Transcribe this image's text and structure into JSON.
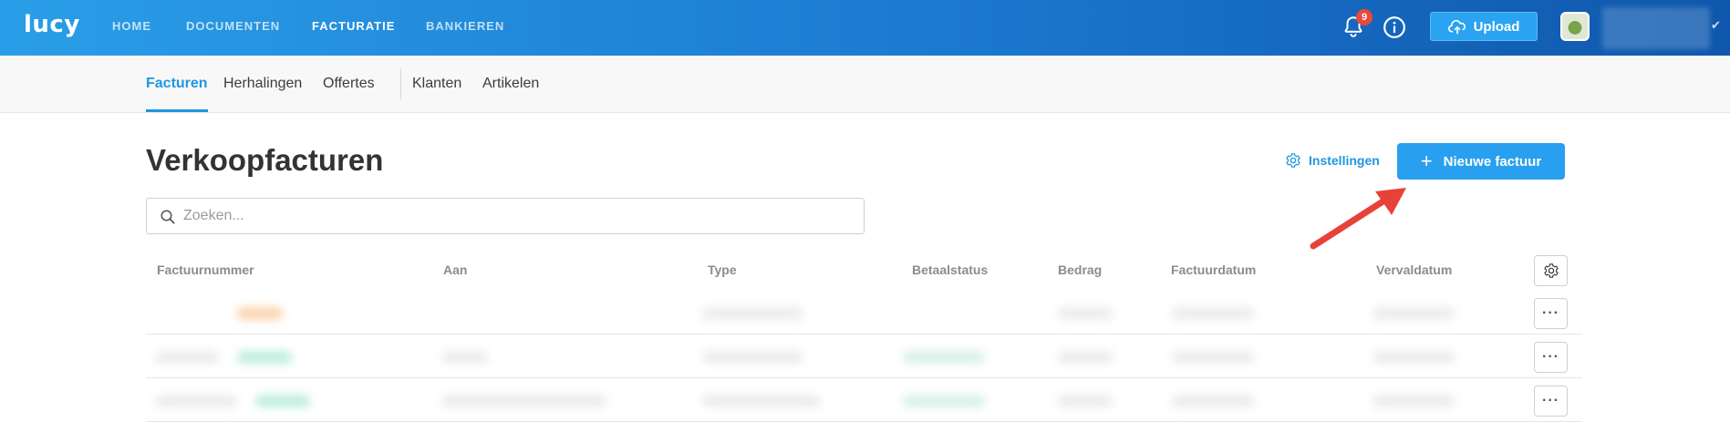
{
  "app": {
    "logo": "lucy"
  },
  "topnav": {
    "items": [
      {
        "label": "HOME",
        "active": false
      },
      {
        "label": "DOCUMENTEN",
        "active": false
      },
      {
        "label": "FACTURATIE",
        "active": true
      },
      {
        "label": "BANKIEREN",
        "active": false
      }
    ],
    "notifications_count": "9",
    "upload_label": "Upload",
    "bell_icon": "bell-icon",
    "info_icon": "info-icon",
    "upload_icon": "cloud-upload-icon"
  },
  "subnav": {
    "items": [
      {
        "label": "Facturen",
        "active": true
      },
      {
        "label": "Herhalingen",
        "active": false
      },
      {
        "label": "Offertes",
        "active": false
      },
      {
        "label": "Klanten",
        "active": false
      },
      {
        "label": "Artikelen",
        "active": false
      }
    ]
  },
  "main": {
    "title": "Verkoopfacturen",
    "settings_label": "Instellingen",
    "new_button_label": "Nieuwe factuur",
    "new_button_icon": "plus-icon",
    "search_placeholder": "Zoeken..."
  },
  "table": {
    "columns": [
      "Factuurnummer",
      "Aan",
      "Type",
      "Betaalstatus",
      "Bedrag",
      "Factuurdatum",
      "Vervaldatum"
    ],
    "row_menu_label": "···",
    "rows_blurred": 3
  },
  "colors": {
    "accent": "#2196e0",
    "topbar_start": "#2a9ee8",
    "topbar_end": "#0f57ac",
    "badge": "#e8483b",
    "annotation_arrow": "#e8413a"
  }
}
